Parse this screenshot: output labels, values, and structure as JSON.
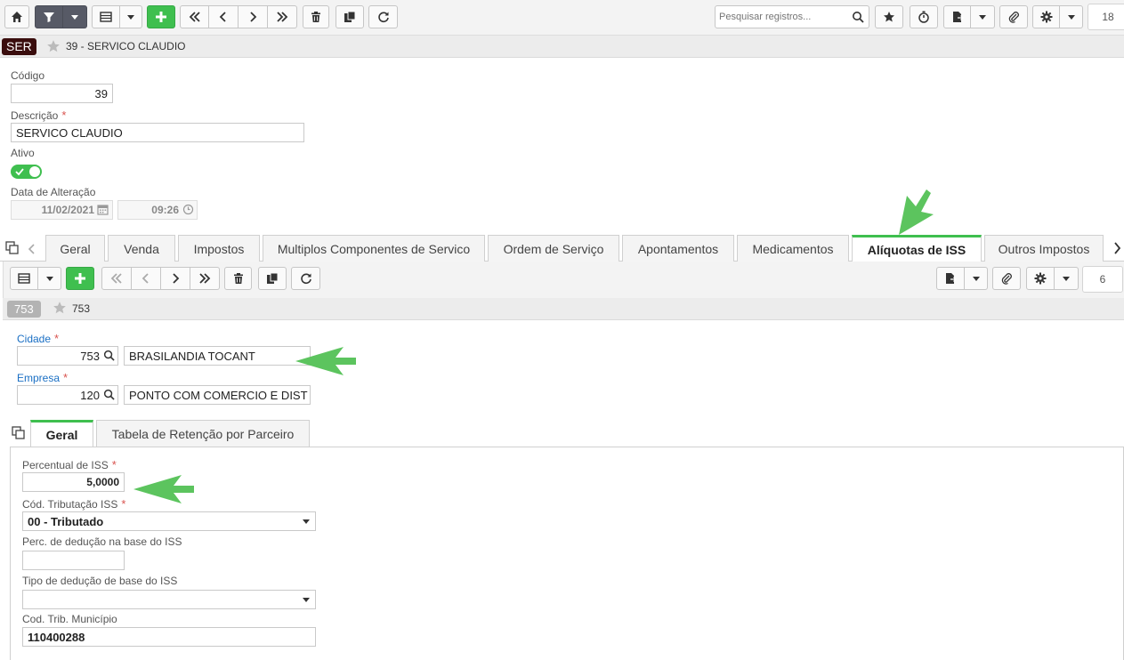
{
  "toolbar": {
    "search_placeholder": "Pesquisar registros...",
    "record_count": "18"
  },
  "record": {
    "badge": "SER",
    "title": "39 - SERVICO CLAUDIO"
  },
  "form": {
    "codigo_label": "Código",
    "codigo_value": "39",
    "descricao_label": "Descrição",
    "descricao_value": "SERVICO CLAUDIO",
    "ativo_label": "Ativo",
    "data_alteracao_label": "Data de Alteração",
    "data_value": "11/02/2021",
    "hora_value": "09:26"
  },
  "tabs": [
    {
      "label": "Geral"
    },
    {
      "label": "Venda"
    },
    {
      "label": "Impostos"
    },
    {
      "label": "Multiplos Componentes de Servico"
    },
    {
      "label": "Ordem de Serviço"
    },
    {
      "label": "Apontamentos"
    },
    {
      "label": "Medicamentos"
    },
    {
      "label": "Alíquotas de ISS"
    },
    {
      "label": "Outros Impostos"
    }
  ],
  "active_tab": "Alíquotas de ISS",
  "subtoolbar": {
    "record_count": "6"
  },
  "subrecord": {
    "badge": "753",
    "title": "753"
  },
  "iss": {
    "cidade_label": "Cidade",
    "cidade_code": "753",
    "cidade_name": "BRASILANDIA TOCANT",
    "empresa_label": "Empresa",
    "empresa_code": "120",
    "empresa_name": "PONTO COM COMERCIO E DIST"
  },
  "subtabs": [
    {
      "label": "Geral"
    },
    {
      "label": "Tabela de Retenção por Parceiro"
    }
  ],
  "geral": {
    "percentual_label": "Percentual de ISS",
    "percentual_value": "5,0000",
    "cod_trib_label": "Cód. Tributação ISS",
    "cod_trib_value": "00 - Tributado",
    "perc_deducao_label": "Perc. de dedução na base do ISS",
    "perc_deducao_value": "",
    "tipo_deducao_label": "Tipo de dedução de base do ISS",
    "tipo_deducao_value": "",
    "cod_trib_mun_label": "Cod. Trib. Município",
    "cod_trib_mun_value": "110400288"
  },
  "colors": {
    "accent_green": "#3fbf4f",
    "arrow_green": "#5cc45e",
    "badge_bg": "#3a0d0d",
    "required": "#d9534f",
    "link_blue": "#1a6fc4"
  }
}
